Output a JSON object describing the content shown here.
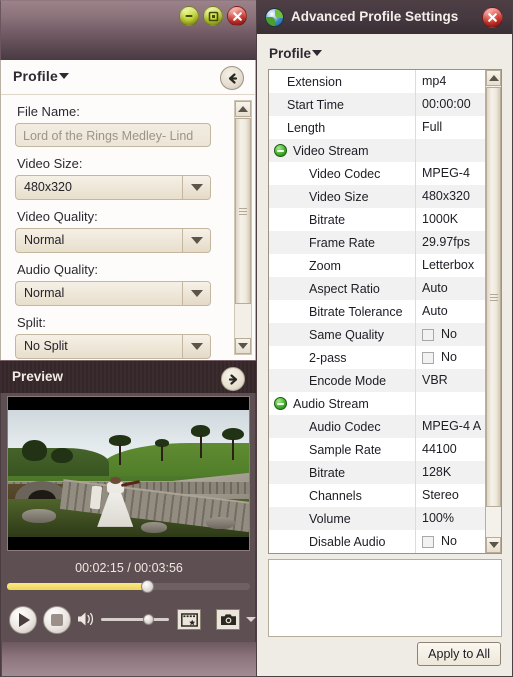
{
  "left_window": {
    "window_controls": [
      {
        "name": "minimize",
        "glyph": "minus"
      },
      {
        "name": "maximize",
        "glyph": "square"
      },
      {
        "name": "close",
        "glyph": "x"
      }
    ],
    "profile_panel": {
      "title": "Profile",
      "back_icon": "arrow-left-icon",
      "fields": [
        {
          "label": "File Name:",
          "type": "text",
          "value": "",
          "placeholder": "Lord of the Rings Medley- Lind"
        },
        {
          "label": "Video Size:",
          "type": "combo",
          "value": "480x320"
        },
        {
          "label": "Video Quality:",
          "type": "combo",
          "value": "Normal"
        },
        {
          "label": "Audio Quality:",
          "type": "combo",
          "value": "Normal"
        },
        {
          "label": "Split:",
          "type": "combo",
          "value": "No Split"
        }
      ]
    },
    "preview_panel": {
      "title": "Preview",
      "forward_icon": "arrow-right-icon",
      "timecode": "00:02:15 / 00:03:56",
      "current_time": "00:02:15",
      "total_time": "00:03:56",
      "progress_percent": 57,
      "volume_percent": 62,
      "controls": [
        {
          "name": "play-button",
          "icon": "play-icon"
        },
        {
          "name": "stop-button",
          "icon": "stop-icon"
        },
        {
          "name": "volume-button",
          "icon": "speaker-icon"
        },
        {
          "name": "snapshot-folder-button",
          "icon": "filmstrip-icon"
        },
        {
          "name": "snapshot-button",
          "icon": "camera-icon"
        },
        {
          "name": "snapshot-menu-button",
          "icon": "chevron-down-icon"
        }
      ]
    }
  },
  "right_window": {
    "title": "Advanced Profile Settings",
    "app_icon": "globe-icon",
    "close_icon": "close-icon",
    "profile_label": "Profile",
    "settings_rows": [
      {
        "name": "Extension",
        "value": "mp4",
        "indent": "root",
        "expander": false,
        "checkbox": false
      },
      {
        "name": "Start Time",
        "value": "00:00:00",
        "indent": "root",
        "expander": false,
        "checkbox": false
      },
      {
        "name": "Length",
        "value": "Full",
        "indent": "root",
        "expander": false,
        "checkbox": false
      },
      {
        "name": "Video Stream",
        "value": "",
        "indent": "group",
        "expander": true,
        "checkbox": false
      },
      {
        "name": "Video Codec",
        "value": "MPEG-4",
        "indent": "child",
        "expander": false,
        "checkbox": false
      },
      {
        "name": "Video Size",
        "value": "480x320",
        "indent": "child",
        "expander": false,
        "checkbox": false
      },
      {
        "name": "Bitrate",
        "value": "1000K",
        "indent": "child",
        "expander": false,
        "checkbox": false
      },
      {
        "name": "Frame Rate",
        "value": "29.97fps",
        "indent": "child",
        "expander": false,
        "checkbox": false
      },
      {
        "name": "Zoom",
        "value": "Letterbox",
        "indent": "child",
        "expander": false,
        "checkbox": false
      },
      {
        "name": "Aspect Ratio",
        "value": "Auto",
        "indent": "child",
        "expander": false,
        "checkbox": false
      },
      {
        "name": "Bitrate Tolerance",
        "value": "Auto",
        "indent": "child",
        "expander": false,
        "checkbox": false
      },
      {
        "name": "Same Quality",
        "value": "No",
        "indent": "child",
        "expander": false,
        "checkbox": true
      },
      {
        "name": "2-pass",
        "value": "No",
        "indent": "child",
        "expander": false,
        "checkbox": true
      },
      {
        "name": "Encode Mode",
        "value": "VBR",
        "indent": "child",
        "expander": false,
        "checkbox": false
      },
      {
        "name": "Audio Stream",
        "value": "",
        "indent": "group",
        "expander": true,
        "checkbox": false
      },
      {
        "name": "Audio Codec",
        "value": "MPEG-4 A",
        "indent": "child",
        "expander": false,
        "checkbox": false
      },
      {
        "name": "Sample Rate",
        "value": "44100",
        "indent": "child",
        "expander": false,
        "checkbox": false
      },
      {
        "name": "Bitrate",
        "value": "128K",
        "indent": "child",
        "expander": false,
        "checkbox": false
      },
      {
        "name": "Channels",
        "value": "Stereo",
        "indent": "child",
        "expander": false,
        "checkbox": false
      },
      {
        "name": "Volume",
        "value": "100%",
        "indent": "child",
        "expander": false,
        "checkbox": false
      },
      {
        "name": "Disable Audio",
        "value": "No",
        "indent": "child",
        "expander": false,
        "checkbox": true
      }
    ],
    "description_box_text": "",
    "apply_button": "Apply to All"
  },
  "colors": {
    "titlebar_top": "#9c838a",
    "titlebar_bottom": "#493a42",
    "right_titlebar": "#453840",
    "accent_yellow": "#efd357",
    "close_red": "#d9352c",
    "expander_green": "#45b12c",
    "panel_bg": "#fdfcfa",
    "preview_bg": "#5d4f52"
  }
}
